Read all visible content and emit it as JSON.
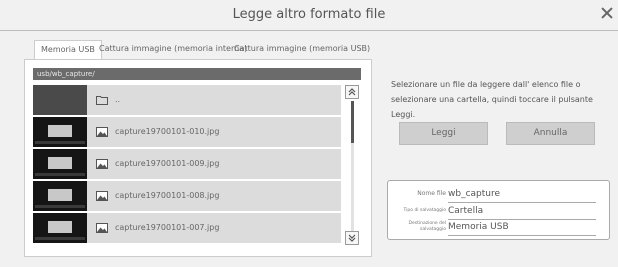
{
  "window": {
    "title": "Legge altro formato file"
  },
  "tabs": [
    {
      "label": "Memoria USB",
      "active": true
    },
    {
      "label": "Cattura immagine (memoria interna)",
      "active": false
    },
    {
      "label": "Cattura immagine (memoria USB)",
      "active": false
    }
  ],
  "file_browser": {
    "path": "usb/wb_capture/",
    "parent_label": "..",
    "files": [
      {
        "name": "capture19700101-010.jpg"
      },
      {
        "name": "capture19700101-009.jpg"
      },
      {
        "name": "capture19700101-008.jpg"
      },
      {
        "name": "capture19700101-007.jpg"
      }
    ]
  },
  "instructions": "Selezionare un file da leggere dall'  elenco file o selezionare una cartella, quindi toccare il pulsante Leggi.",
  "buttons": {
    "read": "Leggi",
    "cancel": "Annulla"
  },
  "info": {
    "filename_label": "Nome file",
    "filename_value": "wb_capture",
    "save_type_label": "Tipo di salvataggio",
    "save_type_value": "Cartella",
    "destination_label": "Destinazione del salvataggio",
    "destination_value": "Memoria USB"
  },
  "colors": {
    "background": "#f1f1f1",
    "path_bar": "#6b6b6b",
    "row": "#dcdcdc",
    "button": "#cfcfcf"
  }
}
